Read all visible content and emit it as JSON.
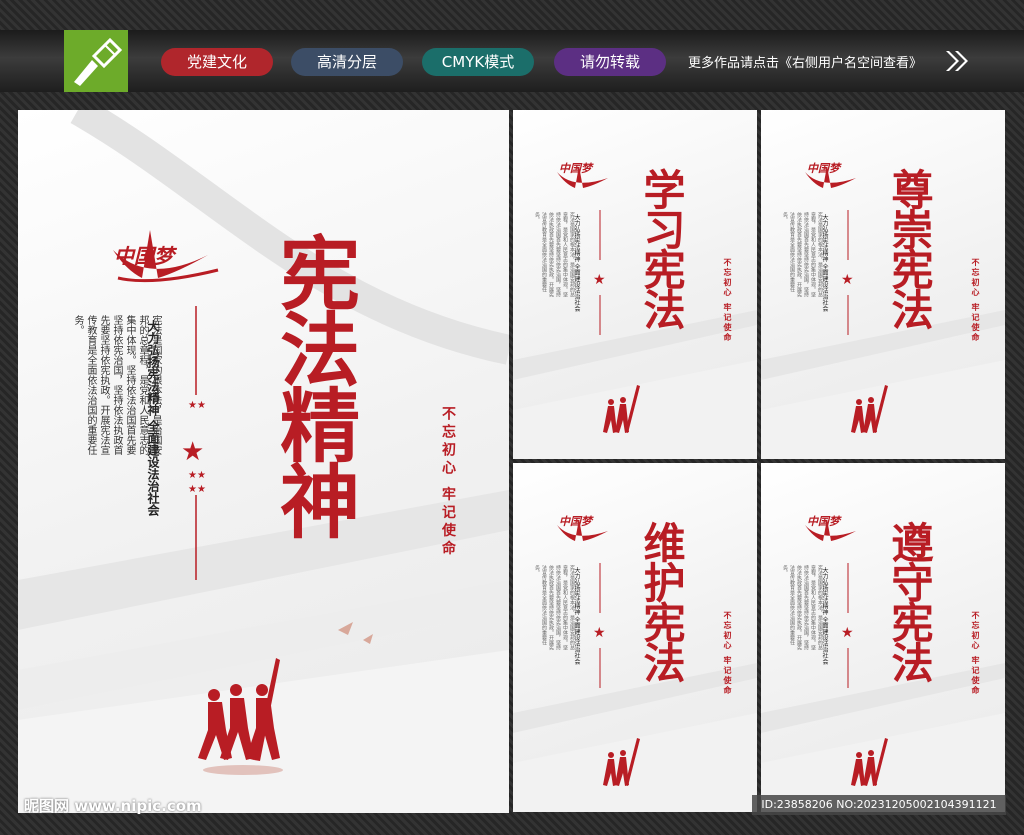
{
  "header": {
    "tags": [
      "党建文化",
      "高清分层",
      "CMYK模式",
      "请勿转载"
    ],
    "more_text": "更多作品请点击《右侧用户名空间查看》",
    "colors": {
      "red": "#b0262c",
      "slate": "#3c4d66",
      "teal": "#1b6e6a",
      "purple": "#5c2f83",
      "logo": "#6dab2a"
    }
  },
  "brand": {
    "logo_text": "中国梦"
  },
  "main_poster": {
    "title": "宪法精神",
    "subtitle": "大力弘扬宪法精神 全面建设法治社会",
    "body": "宪法是国家的根本法，是治国安邦的总章程，是党和人民意志的集中体现。坚持依法治国首先要坚持依宪治国，坚持依法执政首先要坚持依宪执政。开展宪法宣传教育是全面依法治国的重要任务。",
    "slogan": "不忘初心 牢记使命"
  },
  "small_posters": [
    {
      "title": "学习宪法",
      "slogan": "不忘初心 牢记使命"
    },
    {
      "title": "尊崇宪法",
      "slogan": "不忘初心 牢记使命"
    },
    {
      "title": "维护宪法",
      "slogan": "不忘初心 牢记使命"
    },
    {
      "title": "遵守宪法",
      "slogan": "不忘初心 牢记使命"
    }
  ],
  "footer": {
    "watermark": "昵图网 www.nipic.com",
    "id_text": "ID:23858206 NO:20231205002104391121"
  },
  "accent_color": "#b81d24"
}
